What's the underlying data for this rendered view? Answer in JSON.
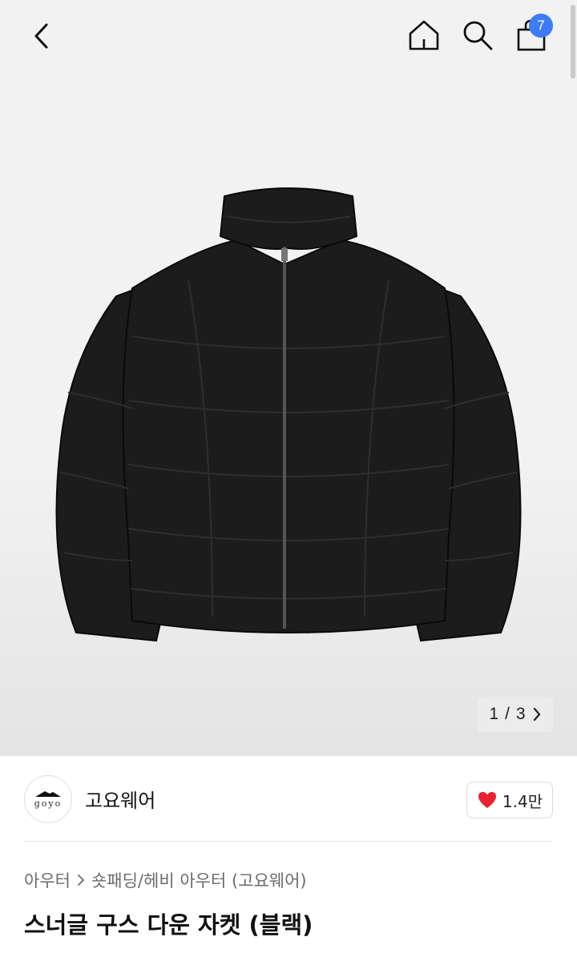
{
  "header": {
    "back_icon": "chevron-left-icon",
    "home_icon": "home-icon",
    "search_icon": "search-icon",
    "cart_icon": "shopping-bag-icon",
    "cart_count": "7",
    "badge_color": "#3d7bf7"
  },
  "gallery": {
    "image": "black puffer down jacket",
    "pager": {
      "current": "1",
      "separator": "/",
      "total": "3",
      "next_icon": "chevron-right-icon"
    }
  },
  "brand": {
    "logo_text": "goyo",
    "name": "고요웨어",
    "likes": {
      "icon": "heart-icon",
      "count": "1.4만",
      "color": "#e8232f"
    }
  },
  "product": {
    "breadcrumb": [
      "아우터",
      "숏패딩/헤비 아우터 (고요웨어)"
    ],
    "title": "스너글 구스 다운 자켓 (블랙)"
  }
}
